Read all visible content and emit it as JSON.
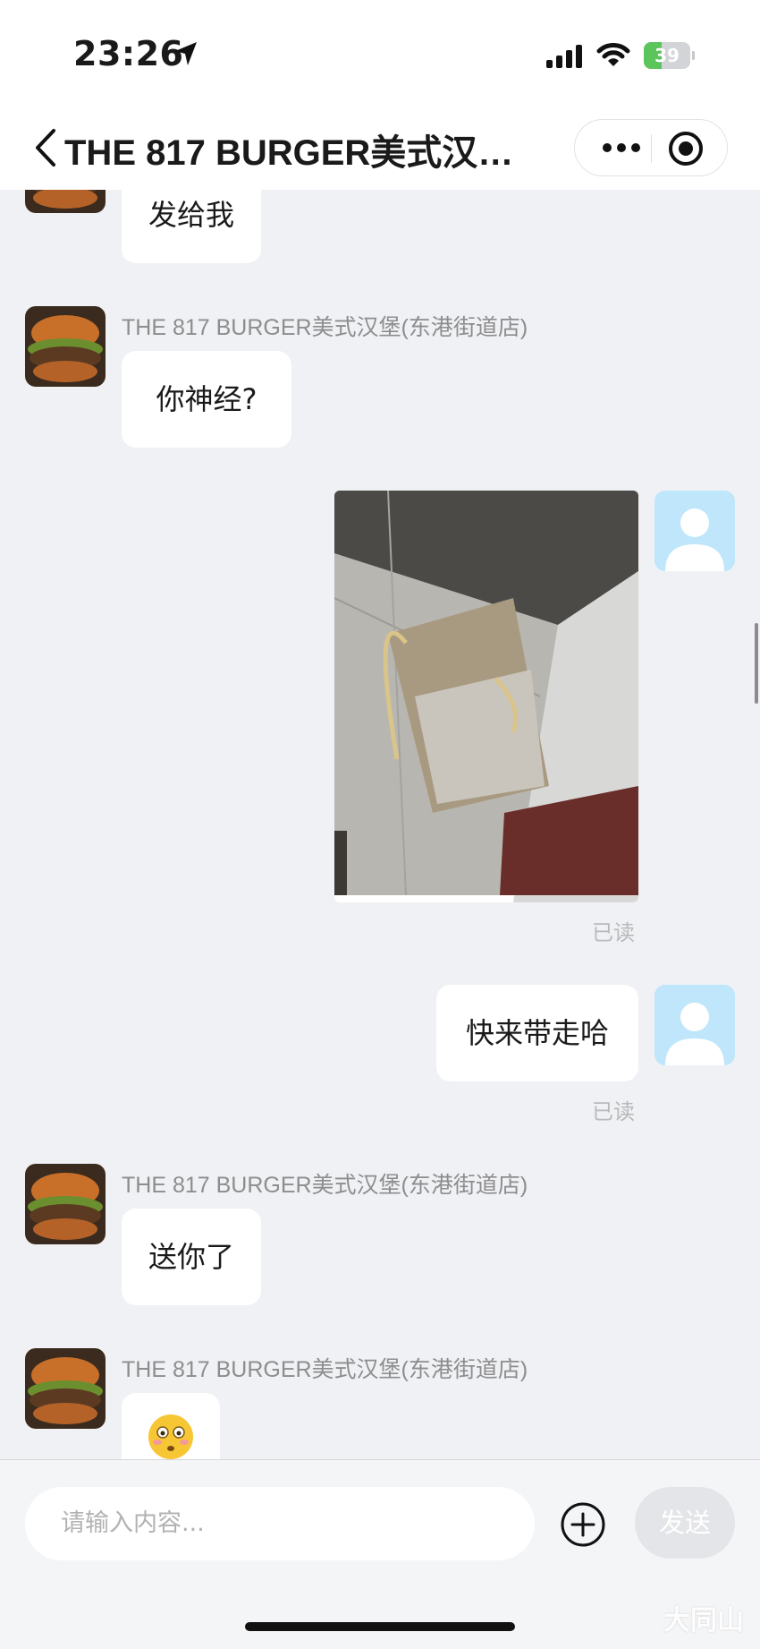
{
  "status_bar": {
    "time": "23:26",
    "battery_level": "39",
    "battery_fraction": 0.39,
    "icons": [
      "location-arrow-icon",
      "cellular-signal-icon",
      "wifi-icon",
      "battery-charging-icon"
    ]
  },
  "nav": {
    "title": "THE 817 BURGER美式汉…",
    "icons": [
      "chevron-left-icon",
      "more-icon",
      "close-target-icon"
    ]
  },
  "chat": {
    "messages": [
      {
        "from": "shop",
        "text": "发给我"
      },
      {
        "from": "shop",
        "sender": "THE 817 BURGER美式汉堡(东港街道店)",
        "text": "你神经?"
      },
      {
        "from": "me",
        "type": "image",
        "receipt": "已读"
      },
      {
        "from": "me",
        "text": "快来带走哈",
        "receipt": "已读"
      },
      {
        "from": "shop",
        "sender": "THE 817 BURGER美式汉堡(东港街道店)",
        "text": "送你了"
      },
      {
        "from": "shop",
        "sender": "THE 817 BURGER美式汉堡(东港街道店)",
        "type": "emoji",
        "emoji": "😳"
      }
    ]
  },
  "input_bar": {
    "placeholder": "请输入内容...",
    "send_label": "发送",
    "plus_icon": "plus-circle-icon"
  },
  "watermark": "大同山",
  "colors": {
    "page_bg": "#f0f1f5",
    "bubble_bg": "#ffffff",
    "my_avatar": "#bfe6fb",
    "battery_green": "#5bc55b",
    "send_disabled": "#e4e5e8"
  }
}
